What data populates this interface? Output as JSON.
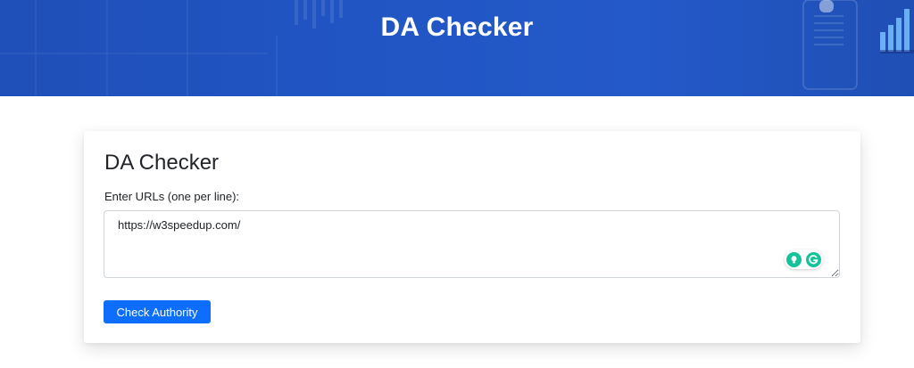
{
  "header": {
    "title": "DA Checker",
    "background_color": "#2155c4"
  },
  "card": {
    "title": "DA Checker",
    "field_label": "Enter URLs (one per line):",
    "textarea_value": "https://w3speedup.com/",
    "button_label": "Check Authority",
    "button_color": "#0d6efd"
  },
  "grammarly_widget": {
    "icons": [
      "lightbulb-icon",
      "grammarly-icon"
    ],
    "accent_color": "#15c39a"
  }
}
